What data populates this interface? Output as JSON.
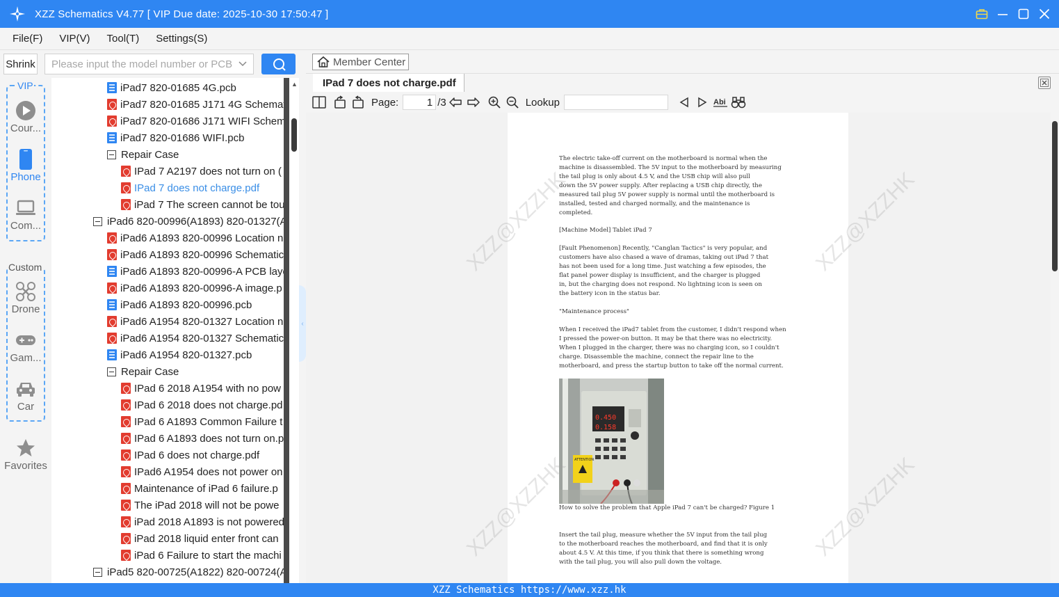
{
  "window": {
    "title": "XZZ Schematics V4.77 [ VIP Due date: 2025-10-30 17:50:47 ]"
  },
  "menu": [
    "File(F)",
    "VIP(V)",
    "Tool(T)",
    "Settings(S)"
  ],
  "search": {
    "shrink_label": "Shrink",
    "placeholder": "Please input the model number or PCB"
  },
  "rail": {
    "vip_label": "VIP",
    "custom_label": "Custom",
    "items": [
      {
        "label": "Cour...",
        "icon": "play-icon"
      },
      {
        "label": "Phone",
        "icon": "phone-icon"
      },
      {
        "label": "Com...",
        "icon": "laptop-icon"
      },
      {
        "label": "Drone",
        "icon": "drone-icon"
      },
      {
        "label": "Gam...",
        "icon": "gamepad-icon"
      },
      {
        "label": "Car",
        "icon": "car-icon"
      },
      {
        "label": "Favorites",
        "icon": "star-icon"
      }
    ]
  },
  "tree": [
    {
      "text": "iPad7 820-01685 4G.pcb",
      "type": "pcb",
      "level": 1
    },
    {
      "text": "iPad7 820-01685 J171 4G Schemat",
      "type": "pdf",
      "level": 1
    },
    {
      "text": "iPad7 820-01686 J171 WIFI Schema",
      "type": "pdf",
      "level": 1
    },
    {
      "text": "iPad7 820-01686 WIFI.pcb",
      "type": "pcb",
      "level": 1
    },
    {
      "text": "Repair Case",
      "type": "folder",
      "level": 1
    },
    {
      "text": "IPad 7 A2197 does not turn on (",
      "type": "pdf",
      "level": 2
    },
    {
      "text": "IPad 7 does not charge.pdf",
      "type": "pdf",
      "level": 2,
      "selected": true
    },
    {
      "text": "iPad 7 The screen cannot be tou",
      "type": "pdf",
      "level": 2
    },
    {
      "text": "iPad6 820-00996(A1893) 820-01327(A",
      "type": "folder",
      "level": 0
    },
    {
      "text": "iPad6 A1893 820-00996 Location n",
      "type": "pdf",
      "level": 1
    },
    {
      "text": "iPad6 A1893 820-00996 Schematic",
      "type": "pdf",
      "level": 1
    },
    {
      "text": "iPad6 A1893 820-00996-A PCB laye",
      "type": "pcb",
      "level": 1
    },
    {
      "text": "iPad6 A1893 820-00996-A image.p",
      "type": "pdf",
      "level": 1
    },
    {
      "text": "iPad6 A1893 820-00996.pcb",
      "type": "pcb",
      "level": 1
    },
    {
      "text": "iPad6 A1954 820-01327 Location n",
      "type": "pdf",
      "level": 1
    },
    {
      "text": "iPad6 A1954 820-01327 Schematic",
      "type": "pdf",
      "level": 1
    },
    {
      "text": "iPad6 A1954 820-01327.pcb",
      "type": "pcb",
      "level": 1
    },
    {
      "text": "Repair Case",
      "type": "folder",
      "level": 1
    },
    {
      "text": "IPad 6 2018 A1954 with no pow",
      "type": "pdf",
      "level": 2
    },
    {
      "text": "IPad 6 2018 does not charge.pd",
      "type": "pdf",
      "level": 2
    },
    {
      "text": "IPad 6 A1893 Common Failure t",
      "type": "pdf",
      "level": 2
    },
    {
      "text": "IPad 6 A1893 does not turn on.p",
      "type": "pdf",
      "level": 2
    },
    {
      "text": "IPad 6 does not charge.pdf",
      "type": "pdf",
      "level": 2
    },
    {
      "text": "IPad6 A1954 does not power on",
      "type": "pdf",
      "level": 2
    },
    {
      "text": "Maintenance of iPad 6 failure.p",
      "type": "pdf",
      "level": 2
    },
    {
      "text": "The iPad 2018 will not be powe",
      "type": "pdf",
      "level": 2
    },
    {
      "text": "iPad 2018 A1893 is not powered",
      "type": "pdf",
      "level": 2
    },
    {
      "text": "iPad 2018 liquid enter front can",
      "type": "pdf",
      "level": 2
    },
    {
      "text": "iPad 6 Failure to start the machi",
      "type": "pdf",
      "level": 2
    },
    {
      "text": "iPad5 820-00725(A1822) 820-00724(A",
      "type": "folder",
      "level": 0
    }
  ],
  "viewer": {
    "member_center": "Member Center",
    "tab_title": "IPad 7 does not charge.pdf",
    "page_label": "Page:",
    "page_current": "1",
    "page_total": "/3",
    "lookup_label": "Lookup",
    "watermark": "XZZ@XZZHK",
    "paragraphs": [
      "The electric take-off current on the motherboard is normal when the\nmachine is disassembled. The 5V input to the motherboard by measuring\nthe tail plug is only about 4.5 V, and the USB chip will also pull\ndown the 5V power supply. After replacing a USB chip directly, the\nmeasured tail plug 5V power supply is normal until the motherboard is\ninstalled, tested and charged normally, and the maintenance is\ncompleted.",
      "[Machine Model] Tablet iPad 7",
      "[Fault Phenomenon] Recently, \"Canglan Tactics\" is very popular, and\ncustomers have also chased a wave of dramas, taking out iPad 7 that\nhas not been used for a long time. Just watching a few episodes, the\nflat panel power display is insufficient, and the charger is plugged\nin, but the charging does not respond. No lightning icon is seen on\nthe battery icon in the status bar.",
      "\"Maintenance process\"",
      "When I received the iPad7 tablet from the customer, I didn't respond when\nI pressed the power-on button. It may be that there was no electricity.\nWhen I plugged in the charger, there was no charging icon, so I couldn't\ncharge. Disassemble the machine, connect the repair line to the\nmotherboard, and press the startup button to take off the normal current.",
      "How to solve the problem that Apple iPad 7 can't be charged? Figure 1",
      "Insert the tail plug, measure whether the 5V input from the tail plug\nto the motherboard reaches the motherboard, and find that it is only\nabout 4.5 V. At this time, if you think that there is something wrong\nwith the tail plug, you will also pull down the voltage."
    ],
    "photo": {
      "display_top": "0.450",
      "display_bottom": "0.158",
      "sticker": "ATTENTION"
    }
  },
  "statusbar": "XZZ Schematics https://www.xzz.hk"
}
